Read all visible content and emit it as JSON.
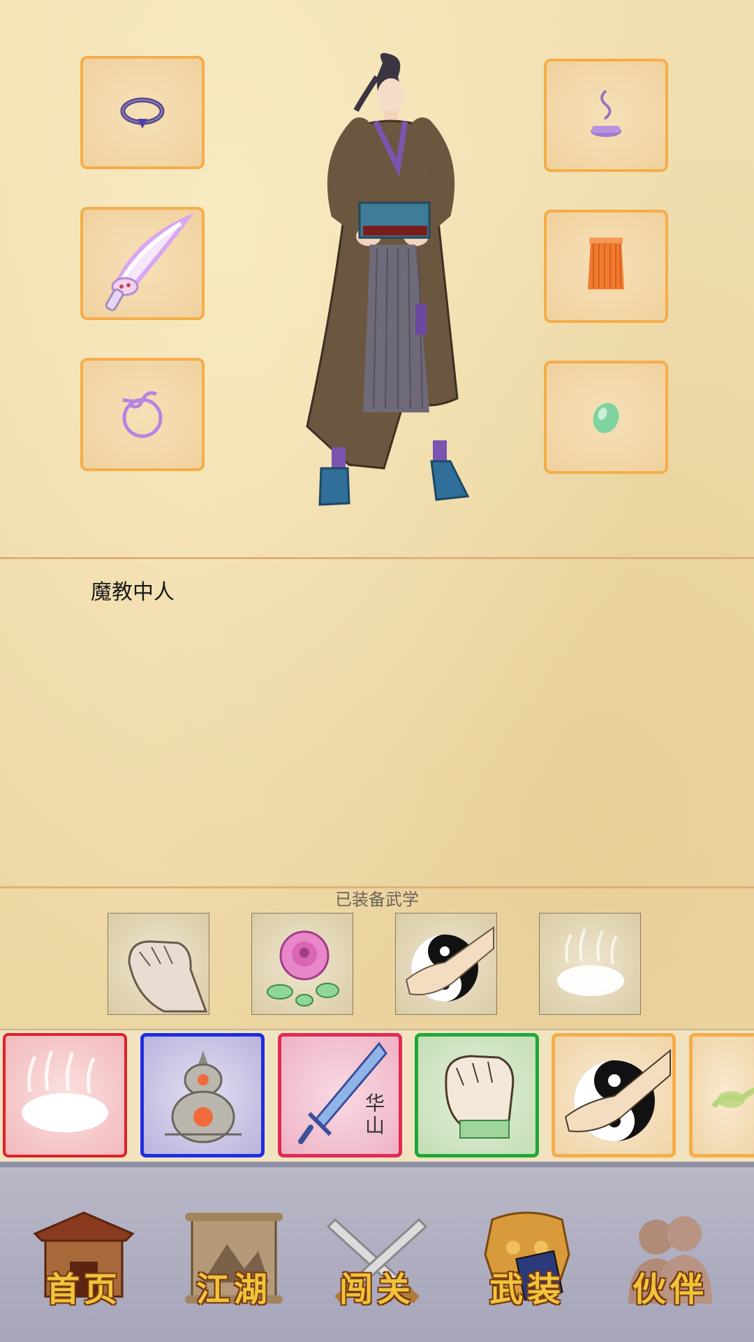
{
  "character": {
    "name": "魔教中人"
  },
  "equipment": {
    "left": [
      {
        "name": "ring-icon",
        "color": "#6e5a9c"
      },
      {
        "name": "saber-icon",
        "color": "#e7b8f5"
      },
      {
        "name": "knot-bracelet-icon",
        "color": "#b884e0"
      }
    ],
    "right": [
      {
        "name": "incense-icon",
        "color": "#9a70c0"
      },
      {
        "name": "robe-icon",
        "color": "#f07b30"
      },
      {
        "name": "jade-icon",
        "color": "#7fd3a0"
      }
    ]
  },
  "martial": {
    "label": "已装备武学",
    "items": [
      {
        "name": "fist-icon"
      },
      {
        "name": "rose-icon"
      },
      {
        "name": "taiji-palm-icon"
      },
      {
        "name": "mist-icon"
      }
    ]
  },
  "skills": [
    {
      "name": "mist-skill",
      "border": "#e0202a",
      "bg": "#f4c4c6"
    },
    {
      "name": "gourd-skill",
      "border": "#1e2ee0",
      "bg": "#c7c3e6"
    },
    {
      "name": "sword-skill",
      "border": "#e02a55",
      "bg": "#f2c0cf",
      "text": "华山"
    },
    {
      "name": "fist-skill",
      "border": "#1fa83a",
      "bg": "#cfe6c2"
    },
    {
      "name": "taiji-skill",
      "border": "#f5ad4a",
      "bg": "#f4dcb5"
    },
    {
      "name": "herb-skill",
      "border": "#f5ad4a",
      "bg": "#f4dcb5"
    }
  ],
  "nav": [
    {
      "key": "home",
      "label": "首页"
    },
    {
      "key": "jianghu",
      "label": "江湖"
    },
    {
      "key": "chuangguan",
      "label": "闯关"
    },
    {
      "key": "wuzhuang",
      "label": "武装"
    },
    {
      "key": "huoban",
      "label": "伙伴"
    }
  ]
}
